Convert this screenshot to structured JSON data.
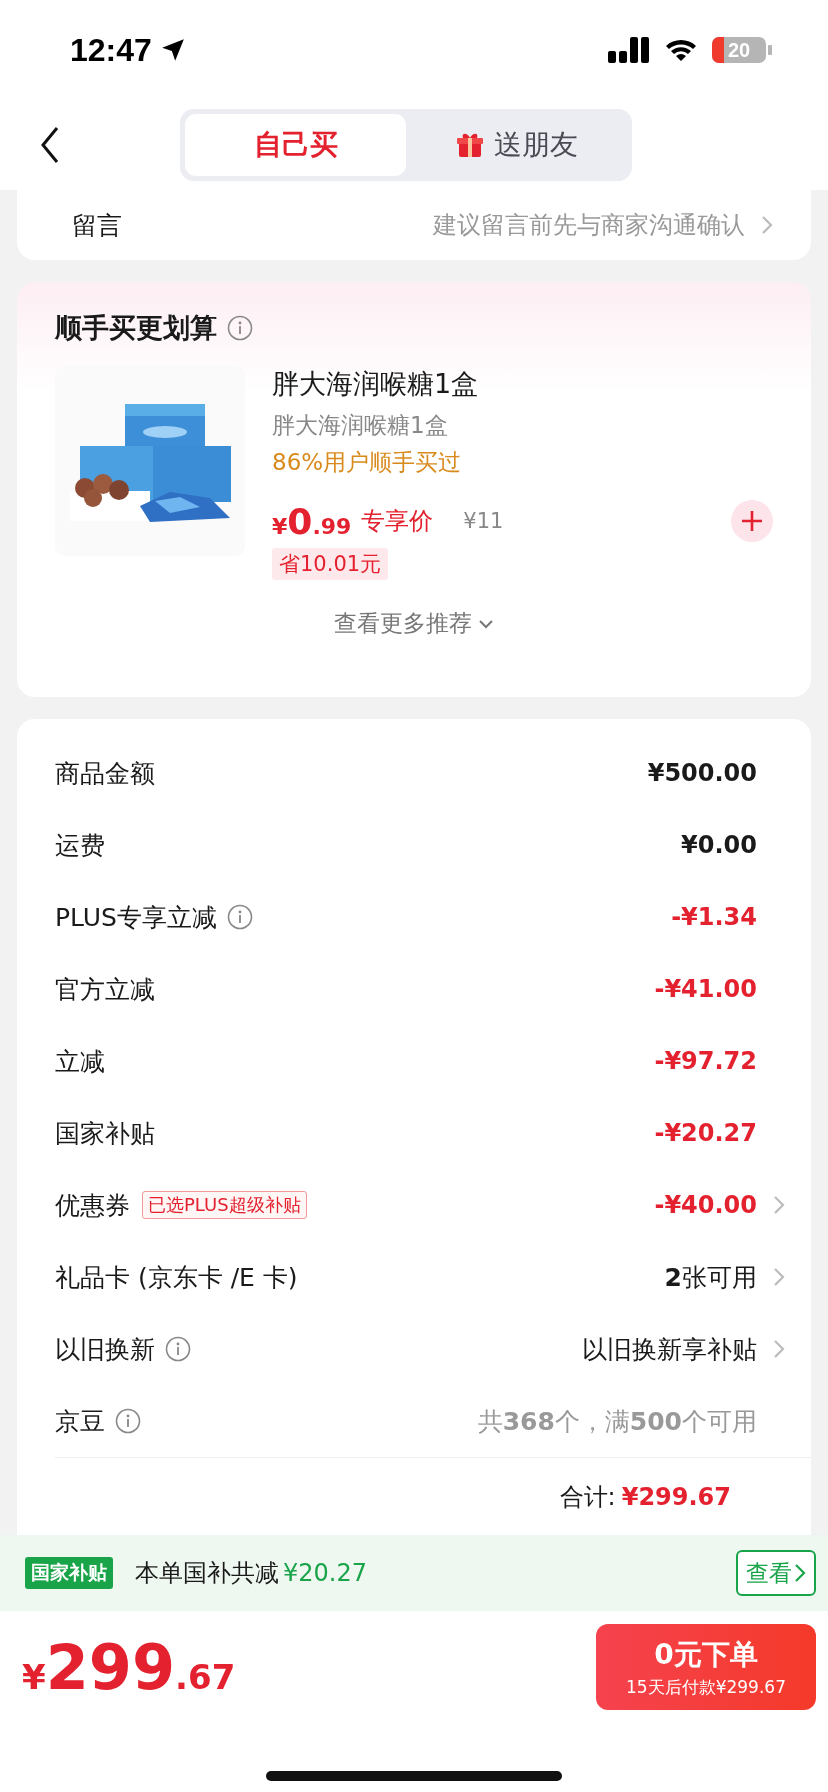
{
  "status_bar": {
    "time": "12:47",
    "battery": "20"
  },
  "header": {
    "tabs": [
      {
        "label": "自己买",
        "selected": true,
        "gift": false
      },
      {
        "label": "送朋友",
        "selected": false,
        "gift": true
      }
    ]
  },
  "note": {
    "label": "留言",
    "hint": "建议留言前先与商家沟通确认"
  },
  "recommend": {
    "title": "顺手买更划算",
    "product": {
      "kind": "picture",
      "name": "胖大海润喉糖1盒",
      "spec": "胖大海润喉糖1盒",
      "social": "86%用户顺手买过",
      "currency": "¥",
      "price_int": "0",
      "price_dec": ".99",
      "price_tag": "专享价",
      "old_price": "¥11",
      "saving": "省10.01元"
    },
    "more": "查看更多推荐"
  },
  "summary": {
    "rows": [
      {
        "label": "商品金额",
        "info": false,
        "value": "¥500.00",
        "kind": "amount",
        "chevron": false
      },
      {
        "label": "运费",
        "info": false,
        "value": "¥0.00",
        "kind": "amount",
        "chevron": false
      },
      {
        "label": "PLUS专享立减",
        "info": true,
        "value": "-¥1.34",
        "kind": "discount",
        "chevron": false
      },
      {
        "label": "官方立减",
        "info": false,
        "value": "-¥41.00",
        "kind": "discount",
        "chevron": false
      },
      {
        "label": "立减",
        "info": false,
        "value": "-¥97.72",
        "kind": "discount",
        "chevron": false
      },
      {
        "label": "国家补贴",
        "info": false,
        "value": "-¥20.27",
        "kind": "discount",
        "chevron": false
      },
      {
        "label": "优惠券",
        "info": false,
        "tag": "已选PLUS超级补贴",
        "value": "-¥40.00",
        "kind": "discount",
        "chevron": true
      },
      {
        "label": "礼品卡 (京东卡 /E 卡)",
        "info": false,
        "value": "**2**张可用",
        "kind": "option",
        "chevron": true
      },
      {
        "label": "以旧换新",
        "info": true,
        "value": "以旧换新享补贴",
        "kind": "option",
        "chevron": true
      },
      {
        "label": "京豆",
        "info": true,
        "value": "共**368**个，满**500**个可用",
        "kind": "hint",
        "chevron": false
      }
    ],
    "total_label": "合计:",
    "total_value": "¥299.67"
  },
  "subsidy_bar": {
    "badge": "国家补贴",
    "text": "本单国补共减",
    "amount": "¥20.27",
    "button": "查看"
  },
  "checkout": {
    "currency": "¥",
    "price_int": "299",
    "price_dec": ".67",
    "button_title": "0元下单",
    "button_sub": "15天后付款¥299.67"
  }
}
